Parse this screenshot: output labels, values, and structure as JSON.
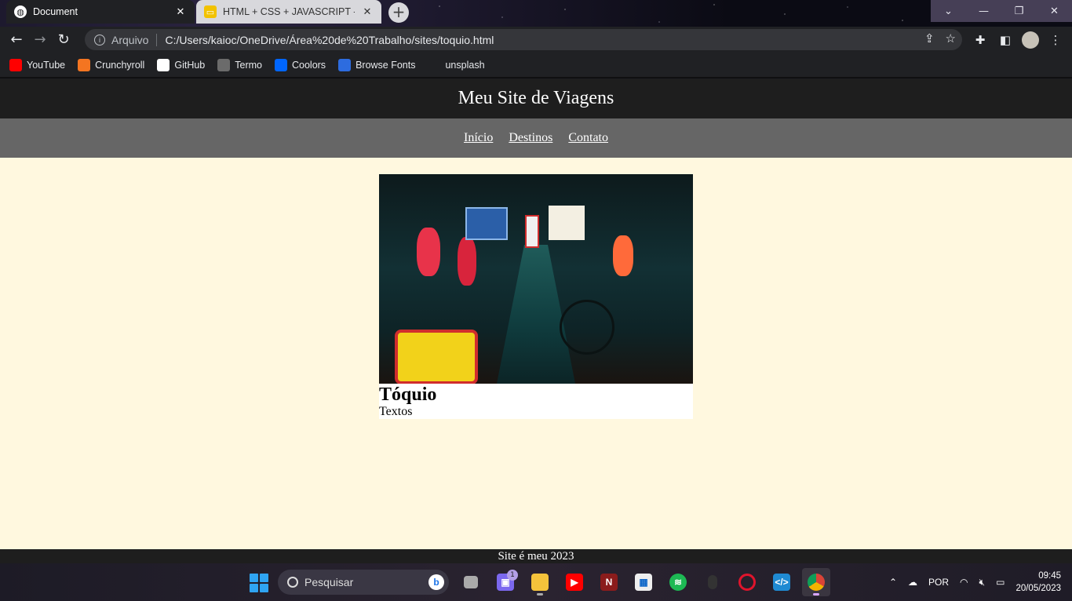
{
  "browser": {
    "tabs": [
      {
        "title": "Document",
        "active": true
      },
      {
        "title": "HTML + CSS + JAVASCRIPT - Ap",
        "active": false
      }
    ],
    "new_tab_symbol": "+",
    "omnibox": {
      "scheme_label": "Arquivo",
      "url": "C:/Users/kaioc/OneDrive/Área%20de%20Trabalho/sites/toquio.html"
    },
    "bookmarks": [
      {
        "label": "YouTube",
        "icon": "youtube-icon",
        "color": "#ff0000"
      },
      {
        "label": "Crunchyroll",
        "icon": "crunchyroll-icon",
        "color": "#f47521"
      },
      {
        "label": "GitHub",
        "icon": "github-icon",
        "color": "#ffffff"
      },
      {
        "label": "Termo",
        "icon": "termo-icon",
        "color": "#6b6b6b"
      },
      {
        "label": "Coolors",
        "icon": "coolors-icon",
        "color": "#0066ff"
      },
      {
        "label": "Browse Fonts",
        "icon": "browse-fonts-icon",
        "color": "#2d6cdf"
      },
      {
        "label": "unsplash",
        "icon": "unsplash-icon",
        "color": "#202124"
      }
    ]
  },
  "site": {
    "header_title": "Meu Site de Viagens",
    "nav": [
      "Início",
      "Destinos",
      "Contato"
    ],
    "card": {
      "title": "Tóquio",
      "text": "Textos"
    },
    "footer": "Site é meu 2023"
  },
  "taskbar": {
    "search_placeholder": "Pesquisar",
    "chat_badge": "1",
    "language": "POR",
    "time": "09:45",
    "date": "20/05/2023"
  }
}
